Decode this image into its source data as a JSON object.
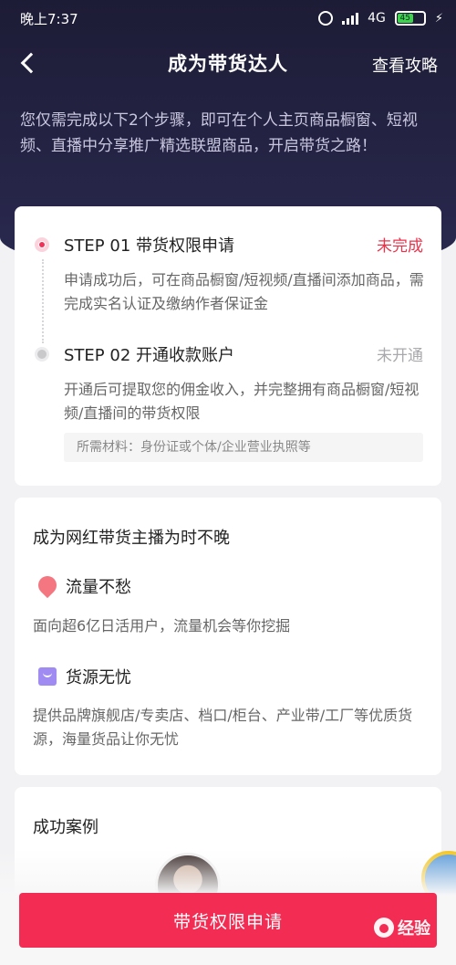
{
  "status_bar": {
    "time": "晚上7:37",
    "network": "4G",
    "battery": "45"
  },
  "nav": {
    "title": "成为带货达人",
    "right_link": "查看攻略"
  },
  "intro": "您仅需完成以下2个步骤，即可在个人主页商品橱窗、短视频、直播中分享推广精选联盟商品，开启带货之路！",
  "steps": [
    {
      "title": "STEP 01 带货权限申请",
      "status": "未完成",
      "status_color": "#e8334b",
      "desc": "申请成功后，可在商品橱窗/短视频/直播间添加商品，需完成实名认证及缴纳作者保证金"
    },
    {
      "title": "STEP 02 开通收款账户",
      "status": "未开通",
      "status_color": "#a9a9ad",
      "desc": "开通后可提取您的佣金收入，并完整拥有商品橱窗/短视频/直播间的带货权限",
      "materials": "所需材料：身份证或个体/企业营业执照等"
    }
  ],
  "why": {
    "title": "成为网红带货主播为时不晚",
    "features": [
      {
        "icon": "flame-icon",
        "title": "流量不愁",
        "desc": "面向超6亿日活用户，流量机会等你挖掘"
      },
      {
        "icon": "shopping-bag-icon",
        "title": "货源无忧",
        "desc": "提供品牌旗舰店/专卖店、档口/柜台、产业带/工厂等优质货源，海量货品让你无忧"
      }
    ]
  },
  "cases": {
    "title": "成功案例"
  },
  "apply_button": "带货权限申请",
  "watermark": "经验",
  "colors": {
    "accent": "#f22c52",
    "header_bg": "#1d1c36"
  }
}
